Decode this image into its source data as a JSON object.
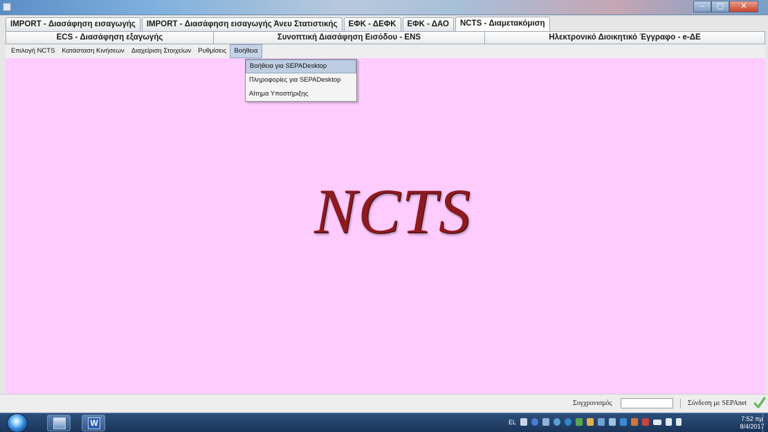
{
  "tabs_row1": [
    {
      "label": "IMPORT - Διασάφηση εισαγωγής",
      "active": false
    },
    {
      "label": "IMPORT - Διασάφηση εισαγωγής Άνευ Στατιστικής",
      "active": false
    },
    {
      "label": "ΕΦΚ - ΔΕΦΚ",
      "active": false
    },
    {
      "label": "ΕΦΚ - ΔΑΟ",
      "active": false
    },
    {
      "label": "NCTS - Διαμετακόμιση",
      "active": true
    }
  ],
  "tabs_row2": [
    {
      "label": "ECS - Διασάφηση εξαγωγής"
    },
    {
      "label": "Συνοπτική Διασάφηση Εισόδου - ENS"
    },
    {
      "label": "Ηλεκτρονικό Διοικητικό Έγγραφο - e-ΔΕ"
    }
  ],
  "menubar": [
    {
      "label": "Επιλογή NCTS",
      "open": false
    },
    {
      "label": "Κατάσταση Κινήσεων",
      "open": false
    },
    {
      "label": "Διαχείριση Στοιχείων",
      "open": false
    },
    {
      "label": "Ρυθμίσεις",
      "open": false
    },
    {
      "label": "Βοήθεια",
      "open": true
    }
  ],
  "dropdown": [
    {
      "label": "Βοήθεια για SEPADesktop",
      "hover": true
    },
    {
      "label": "Πληροφορίες για SEPADesktop",
      "hover": false
    },
    {
      "label": "Αίτημα Υποστήριξης",
      "hover": false
    }
  ],
  "main": {
    "logo_text": "NCTS",
    "background": "#ffccff"
  },
  "statusbar": {
    "sync_label": "Συγχρονισμός",
    "connection_label": "Σύνδεση με SEPAnet",
    "connection_icon": "green-check-icon"
  },
  "taskbar": {
    "apps": [
      {
        "name": "sepa-desktop-app",
        "label": ""
      },
      {
        "name": "word-app",
        "label": "W"
      }
    ],
    "language": "EL",
    "clock_time": "7:52 πμ",
    "clock_date": "8/4/2017"
  },
  "colors": {
    "main_bg": "#ffccff",
    "logo": "#8c1a1f",
    "menu_highlight": "#c5d3e8",
    "taskbar": "#1b3559"
  }
}
